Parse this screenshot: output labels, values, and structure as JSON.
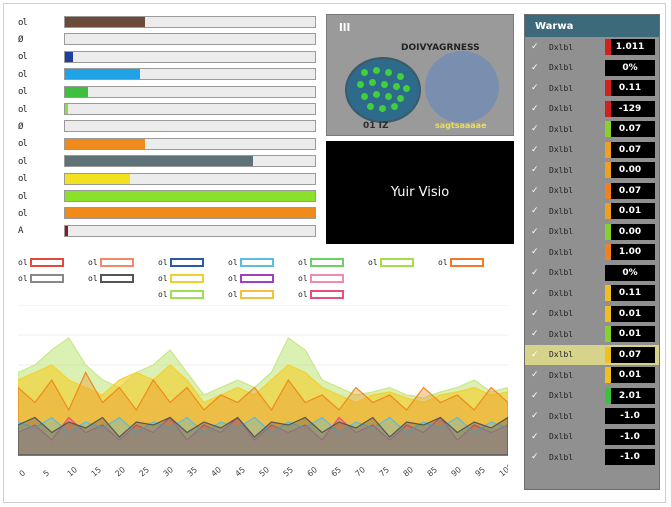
{
  "bars": [
    {
      "label": "ol",
      "value": 0.32,
      "color": "#6b4a3a"
    },
    {
      "label": "Ø",
      "value": 0.0,
      "color": "#cccccc"
    },
    {
      "label": "ol",
      "value": 0.03,
      "color": "#1f3fa0"
    },
    {
      "label": "ol",
      "value": 0.3,
      "color": "#1fa3e6"
    },
    {
      "label": "ol",
      "value": 0.09,
      "color": "#3fbf3f"
    },
    {
      "label": "ol",
      "value": 0.01,
      "color": "#8fdc3a"
    },
    {
      "label": "Ø",
      "value": 0.0,
      "color": "#cccccc"
    },
    {
      "label": "ol",
      "value": 0.32,
      "color": "#f08a1a"
    },
    {
      "label": "ol",
      "value": 0.75,
      "color": "#5f7278"
    },
    {
      "label": "ol",
      "value": 0.26,
      "color": "#f3e020"
    },
    {
      "label": "ol",
      "value": 1.0,
      "color": "#8ae02a"
    },
    {
      "label": "ol",
      "value": 1.0,
      "color": "#f08a1a"
    },
    {
      "label": "A",
      "value": 0.01,
      "color": "#8a1a2a"
    }
  ],
  "thumbnail": {
    "header": "lll",
    "subtitle": "DOIVYAGRNESS",
    "caption_left": "01 IZ",
    "caption_right": "sagtsaaaae"
  },
  "video": {
    "label": "Yuir Visio"
  },
  "legend": [
    {
      "label": "ol",
      "color": "#e04a3a"
    },
    {
      "label": "ol",
      "color": "#f08a6a"
    },
    {
      "label": "ol",
      "color": "#2a5aa0"
    },
    {
      "label": "ol",
      "color": "#5abce0"
    },
    {
      "label": "ol",
      "color": "#6ad06a"
    },
    {
      "label": "ol",
      "color": "#a8dc4a"
    },
    {
      "label": "ol",
      "color": "#f07a2a"
    },
    {
      "label": "ol",
      "color": "#888888"
    },
    {
      "label": "ol",
      "color": "#555555"
    },
    {
      "label": "ol",
      "color": "#f3d030"
    },
    {
      "label": "ol",
      "color": "#a040c0"
    },
    {
      "label": "ol",
      "color": "#f28ab0"
    },
    {
      "label": "ol",
      "color": "#9ae05a"
    },
    {
      "label": "ol",
      "color": "#f5c040"
    },
    {
      "label": "ol",
      "color": "#e8507a"
    }
  ],
  "chart_data": {
    "type": "area",
    "x_ticks": [
      "0",
      "5",
      "10",
      "15",
      "20",
      "25",
      "30",
      "35",
      "40",
      "45",
      "50",
      "55",
      "60",
      "65",
      "70",
      "75",
      "80",
      "85",
      "90",
      "95",
      "100"
    ],
    "series": [
      {
        "color": "#c8e88a",
        "values": [
          0.55,
          0.6,
          0.7,
          0.78,
          0.6,
          0.5,
          0.45,
          0.55,
          0.6,
          0.7,
          0.55,
          0.4,
          0.45,
          0.5,
          0.45,
          0.55,
          0.78,
          0.7,
          0.5,
          0.45,
          0.4,
          0.42,
          0.45,
          0.4,
          0.38,
          0.42,
          0.45,
          0.5,
          0.42,
          0.45
        ]
      },
      {
        "color": "#f5d030",
        "values": [
          0.5,
          0.55,
          0.6,
          0.5,
          0.45,
          0.4,
          0.5,
          0.55,
          0.5,
          0.6,
          0.5,
          0.35,
          0.4,
          0.45,
          0.4,
          0.5,
          0.6,
          0.55,
          0.45,
          0.4,
          0.35,
          0.4,
          0.42,
          0.38,
          0.35,
          0.4,
          0.42,
          0.45,
          0.4,
          0.42
        ]
      },
      {
        "color": "#f08a1a",
        "values": [
          0.45,
          0.35,
          0.5,
          0.3,
          0.55,
          0.35,
          0.45,
          0.3,
          0.5,
          0.35,
          0.45,
          0.3,
          0.4,
          0.35,
          0.45,
          0.3,
          0.5,
          0.35,
          0.4,
          0.3,
          0.45,
          0.35,
          0.4,
          0.3,
          0.45,
          0.35,
          0.4,
          0.3,
          0.45,
          0.35
        ]
      },
      {
        "color": "#e8507a",
        "values": [
          0.15,
          0.2,
          0.1,
          0.25,
          0.15,
          0.2,
          0.1,
          0.2,
          0.15,
          0.25,
          0.1,
          0.2,
          0.15,
          0.25,
          0.1,
          0.2,
          0.15,
          0.2,
          0.1,
          0.25,
          0.15,
          0.2,
          0.1,
          0.2,
          0.15,
          0.25,
          0.1,
          0.2,
          0.15,
          0.2
        ]
      },
      {
        "color": "#5abce0",
        "values": [
          0.22,
          0.18,
          0.25,
          0.15,
          0.22,
          0.18,
          0.25,
          0.15,
          0.22,
          0.18,
          0.25,
          0.15,
          0.22,
          0.18,
          0.25,
          0.15,
          0.22,
          0.18,
          0.25,
          0.15,
          0.22,
          0.18,
          0.25,
          0.15,
          0.22,
          0.18,
          0.25,
          0.15,
          0.22,
          0.18
        ]
      },
      {
        "color": "#555555",
        "values": [
          0.2,
          0.25,
          0.15,
          0.22,
          0.18,
          0.25,
          0.12,
          0.22,
          0.2,
          0.25,
          0.15,
          0.22,
          0.18,
          0.25,
          0.12,
          0.22,
          0.2,
          0.25,
          0.15,
          0.22,
          0.18,
          0.25,
          0.12,
          0.22,
          0.2,
          0.25,
          0.15,
          0.22,
          0.18,
          0.25
        ]
      }
    ]
  },
  "table": {
    "header": "Warwa",
    "rows": [
      {
        "name": "Dxlbl",
        "value": "1.011",
        "flag": "#d02020"
      },
      {
        "name": "Dxlbl",
        "value": "0%",
        "flag": ""
      },
      {
        "name": "Dxlbl",
        "value": "0.11",
        "flag": "#d02020"
      },
      {
        "name": "Dxlbl",
        "value": "-129",
        "flag": "#d02020"
      },
      {
        "name": "Dxlbl",
        "value": "0.07",
        "flag": "#8ad02a"
      },
      {
        "name": "Dxlbl",
        "value": "0.07",
        "flag": "#f0a020"
      },
      {
        "name": "Dxlbl",
        "value": "0.00",
        "flag": "#f0a020"
      },
      {
        "name": "Dxlbl",
        "value": "0.07",
        "flag": "#f08020"
      },
      {
        "name": "Dxlbl",
        "value": "0.01",
        "flag": "#f0a020"
      },
      {
        "name": "Dxlbl",
        "value": "0.00",
        "flag": "#8ad02a"
      },
      {
        "name": "Dxlbl",
        "value": "1.00",
        "flag": "#f08020"
      },
      {
        "name": "Dxlbl",
        "value": "0%",
        "flag": ""
      },
      {
        "name": "Dxlbl",
        "value": "0.11",
        "flag": "#f0c020"
      },
      {
        "name": "Dxlbl",
        "value": "0.01",
        "flag": "#f0c020"
      },
      {
        "name": "Dxlbl",
        "value": "0.01",
        "flag": "#8ad02a"
      },
      {
        "name": "Dxlbl",
        "value": "0.07",
        "flag": "#f0c020"
      },
      {
        "name": "Dxlbl",
        "value": "0.01",
        "flag": "#f0c020"
      },
      {
        "name": "Dxlbl",
        "value": "2.01",
        "flag": "#3fbf3f"
      },
      {
        "name": "Dxlbl",
        "value": "-1.0",
        "flag": ""
      },
      {
        "name": "Dxlbl",
        "value": "-1.0",
        "flag": ""
      },
      {
        "name": "Dxlbl",
        "value": "-1.0",
        "flag": ""
      }
    ],
    "selected_row": 15
  }
}
